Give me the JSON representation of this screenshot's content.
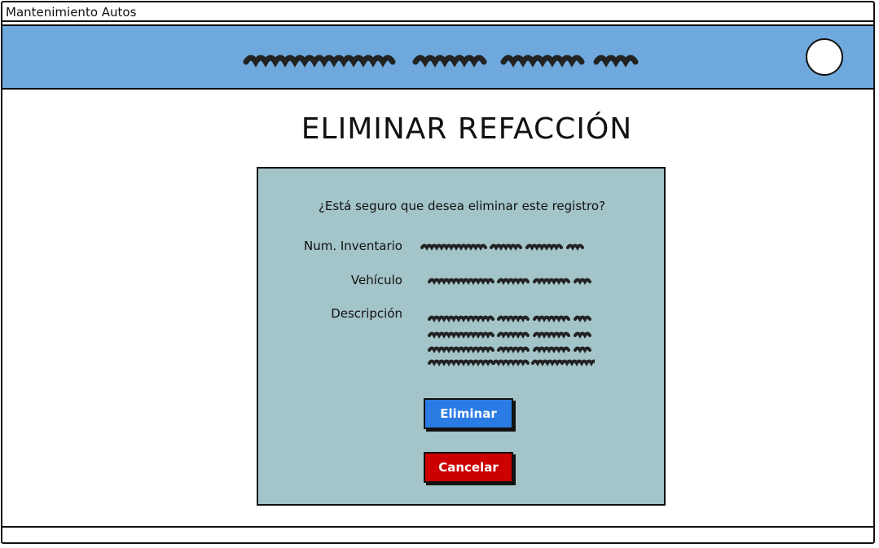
{
  "window": {
    "title": "Mantenimiento Autos"
  },
  "header": {
    "title_placeholder": "scribbled-title-text",
    "avatar_icon": "user-avatar-icon"
  },
  "page": {
    "title": "ELIMINAR REFACCIÓN"
  },
  "dialog": {
    "question": "¿Está seguro que desea eliminar este registro?",
    "fields": [
      {
        "label": "Num. Inventario"
      },
      {
        "label": "Vehículo"
      },
      {
        "label": "Descripción"
      }
    ],
    "buttons": {
      "delete_label": "Eliminar",
      "cancel_label": "Cancelar"
    }
  },
  "colors": {
    "header_band": "#6fa8dc",
    "dialog_bg": "#a3c4c8",
    "delete_button": "#2b7be4",
    "cancel_button": "#cc0000"
  }
}
